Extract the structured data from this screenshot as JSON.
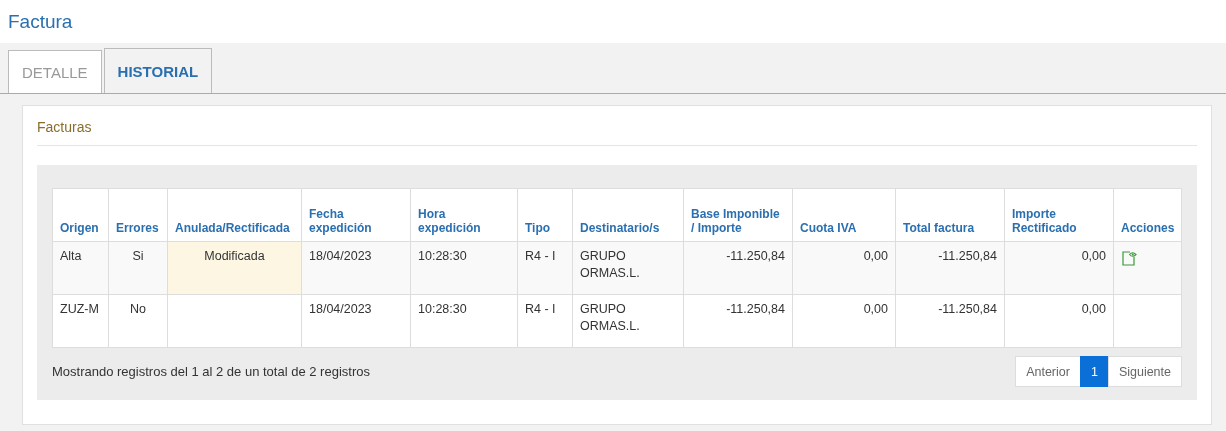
{
  "title": "Factura",
  "tabs": [
    {
      "label": "DETALLE",
      "selected": false
    },
    {
      "label": "HISTORIAL",
      "selected": true
    }
  ],
  "panel": {
    "title": "Facturas",
    "table": {
      "columns": [
        "Origen",
        "Errores",
        "Anulada/Rectificada",
        "Fecha expedición",
        "Hora expedición",
        "Tipo",
        "Destinatario/s",
        "Base Imponible / Importe",
        "Cuota IVA",
        "Total factura",
        "Importe Rectificado",
        "Acciones"
      ],
      "rows": [
        {
          "origen": "Alta",
          "errores": "Si",
          "anulada": "Modificada",
          "modified": true,
          "fecha": "18/04/2023",
          "hora": "10:28:30",
          "tipo": "R4 - I",
          "destinatario": "GRUPO ORMAS.L.",
          "base": "-11.250,84",
          "cuota": "0,00",
          "total": "-11.250,84",
          "rectificado": "0,00",
          "has_action": true
        },
        {
          "origen": "ZUZ-M",
          "errores": "No",
          "modified": false,
          "fecha": "18/04/2023",
          "hora": "10:28:30",
          "tipo": "R4 - I",
          "destinatario": "GRUPO ORMAS.L.",
          "base": "-11.250,84",
          "cuota": "0,00",
          "total": "-11.250,84",
          "rectificado": "0,00",
          "has_action": false
        }
      ]
    },
    "info": "Mostrando registros del 1 al 2 de un total de 2 registros",
    "pagination": [
      {
        "label": "Anterior",
        "selected": false
      },
      {
        "label": "1",
        "selected": true
      },
      {
        "label": "Siguiente",
        "selected": false
      }
    ]
  }
}
